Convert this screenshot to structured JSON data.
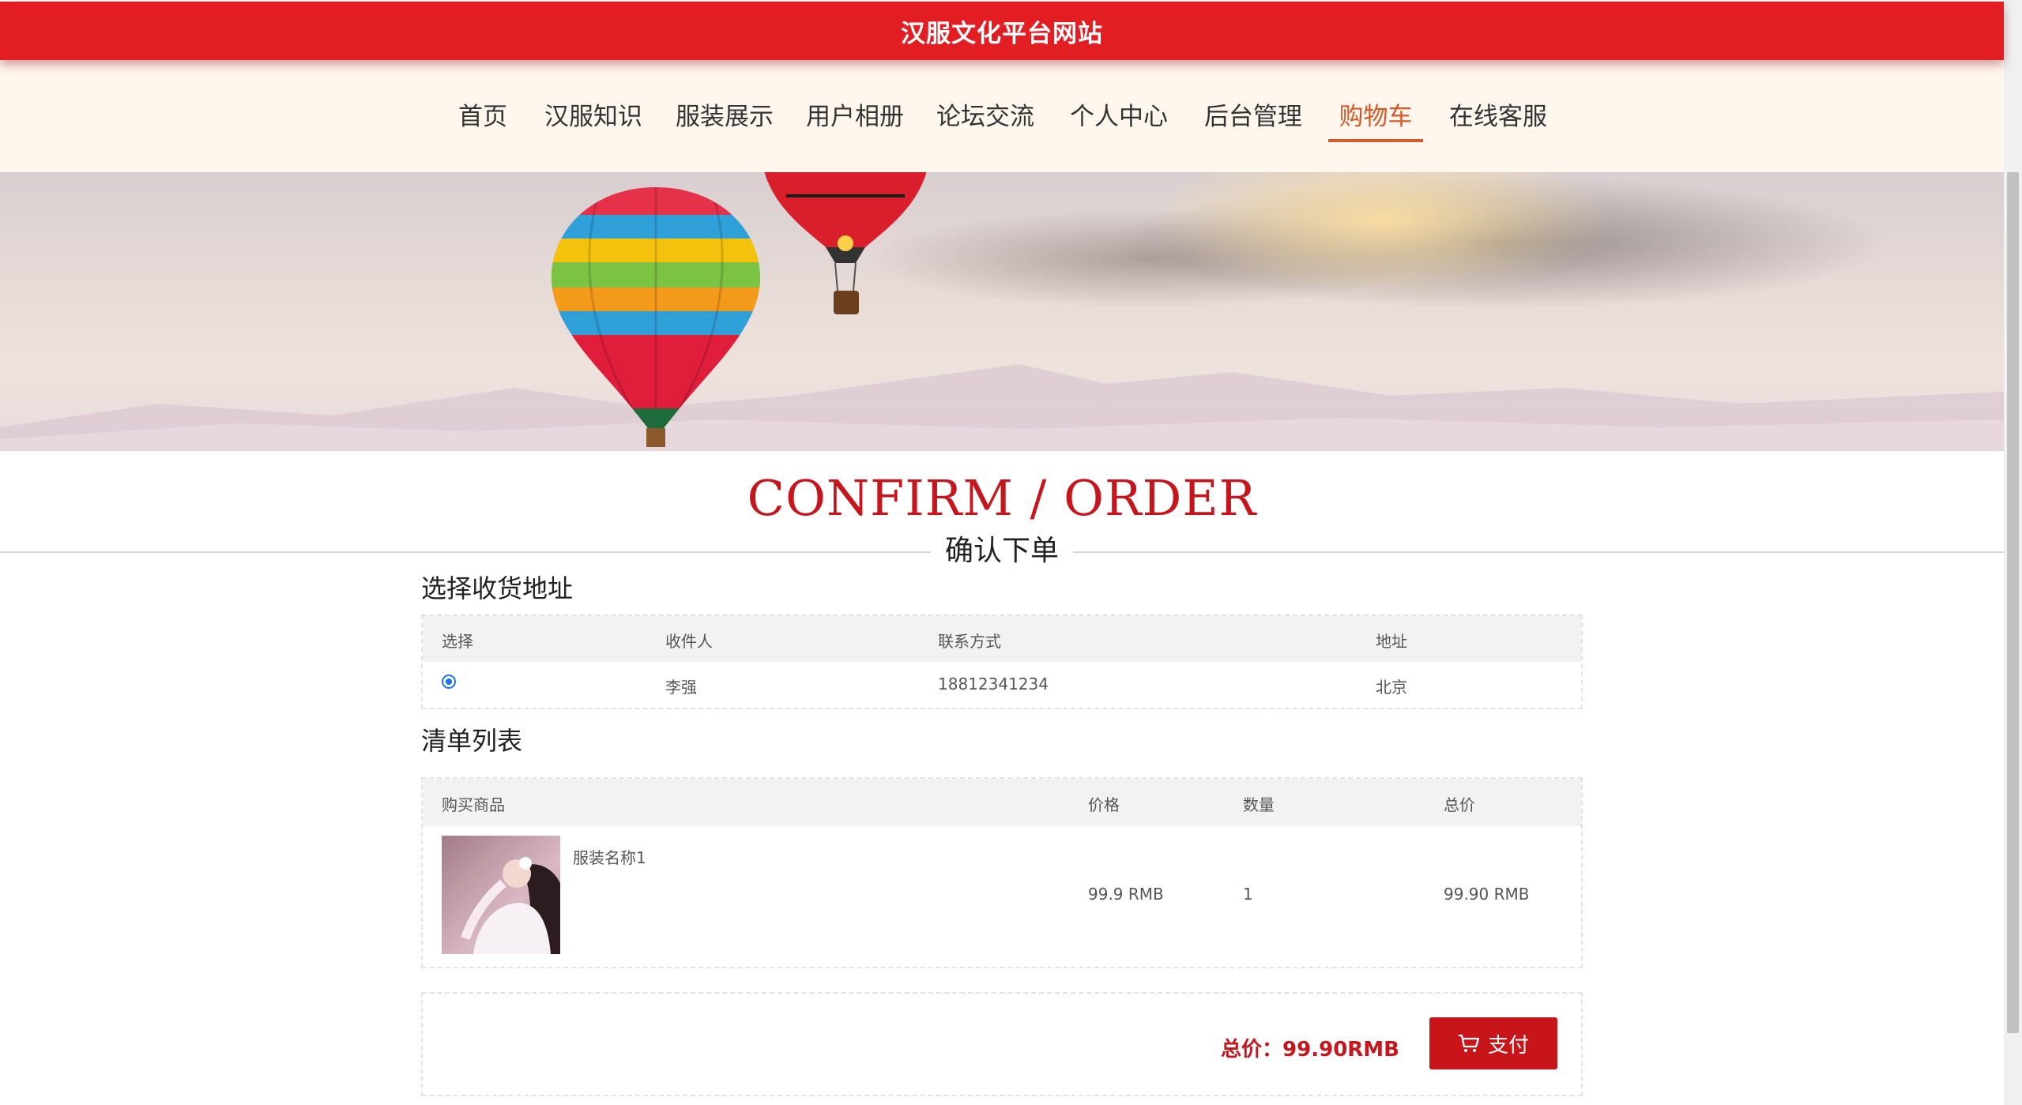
{
  "site": {
    "title": "汉服文化平台网站"
  },
  "nav": {
    "items": [
      {
        "label": "首页"
      },
      {
        "label": "汉服知识"
      },
      {
        "label": "服装展示"
      },
      {
        "label": "用户相册"
      },
      {
        "label": "论坛交流"
      },
      {
        "label": "个人中心"
      },
      {
        "label": "后台管理"
      },
      {
        "label": "购物车",
        "active": true
      },
      {
        "label": "在线客服"
      }
    ]
  },
  "heading": {
    "en": "CONFIRM / ORDER",
    "cn": "确认下单"
  },
  "address": {
    "title": "选择收货地址",
    "headers": {
      "select": "选择",
      "receiver": "收件人",
      "contact": "联系方式",
      "addr": "地址"
    },
    "rows": [
      {
        "selected": true,
        "receiver": "李强",
        "contact": "18812341234",
        "addr": "北京"
      }
    ]
  },
  "list": {
    "title": "清单列表",
    "headers": {
      "product": "购买商品",
      "price": "价格",
      "qty": "数量",
      "total": "总价"
    },
    "rows": [
      {
        "name": "服装名称1",
        "price": "99.9 RMB",
        "qty": "1",
        "total": "99.90 RMB"
      }
    ]
  },
  "summary": {
    "total_label": "总价：99.90RMB",
    "pay_label": "支付"
  },
  "colors": {
    "brand": "#e21e22",
    "accent": "#c4161c",
    "nav_active": "#d45a2a",
    "nav_bg": "#fff6ee"
  },
  "icons": {
    "pay": "cart-icon",
    "radio": "radio-selected-icon"
  }
}
